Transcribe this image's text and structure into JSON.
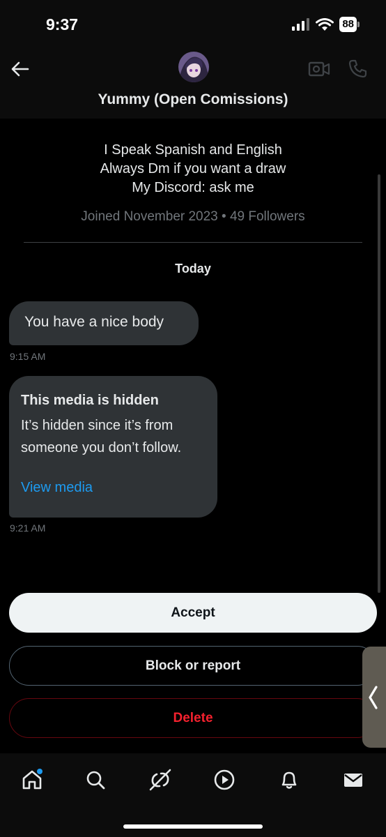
{
  "status_bar": {
    "time": "9:37",
    "battery": "88"
  },
  "header": {
    "title": "Yummy (Open Comissions)"
  },
  "profile": {
    "bio_lines": [
      "I Speak Spanish and English",
      "Always Dm if you want a draw",
      "My Discord: ask me"
    ],
    "joined": "Joined November 2023 • 49 Followers"
  },
  "date_separator": "Today",
  "messages": [
    {
      "text": "You have a nice body",
      "time": "9:15 AM"
    },
    {
      "hidden_title": "This media is hidden",
      "hidden_body": "It’s hidden since it’s from someone you don’t follow.",
      "link": "View media",
      "time": "9:21 AM"
    }
  ],
  "actions": {
    "accept": "Accept",
    "block": "Block or report",
    "delete": "Delete"
  },
  "colors": {
    "accent": "#1d9bf0",
    "danger": "#f4212e",
    "bubble": "#2f3336",
    "muted": "#71767b"
  },
  "icons": [
    "back-arrow-icon",
    "video-icon",
    "phone-icon",
    "home-icon",
    "search-icon",
    "grok-icon",
    "play-icon",
    "bell-icon",
    "mail-icon"
  ]
}
